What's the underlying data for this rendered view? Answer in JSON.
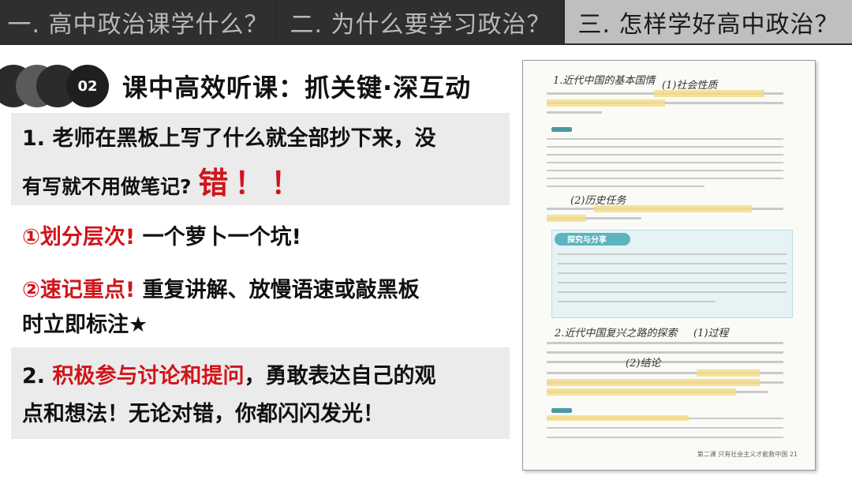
{
  "tabs": [
    {
      "label": "一. 高中政治课学什么？"
    },
    {
      "label": "二. 为什么要学习政治？"
    },
    {
      "label": "三. 怎样学好高中政治？"
    }
  ],
  "section": {
    "number": "02",
    "title": "课中高效听课：抓关键·深互动"
  },
  "point1": {
    "line1": "1. 老师在黑板上写了什么就全部抄下来，没",
    "line2": "有写就不用做笔记?",
    "verdict": "错！！"
  },
  "tip1": {
    "label": "①划分层次!",
    "text": "一个萝卜一个坑!"
  },
  "tip2": {
    "label": "②速记重点!",
    "text_line1": "重复讲解、放慢语速或敲黑板",
    "text_line2": "时立即标注★"
  },
  "point2": {
    "prefix": "2. ",
    "highlight": "积极参与讨论和提问",
    "rest_line1": "，勇敢表达自己的观",
    "line2": "点和想法！无论对错，你都闪闪发光！"
  },
  "textbook_page": {
    "annotations": [
      "1.近代中国的基本国情",
      "(1)社会性质",
      "(2)历史任务",
      "2.近代中国复兴之路的探索",
      "(1)过程",
      "(2)结论"
    ],
    "teal_header": "探究与分享",
    "footer": "第二课 只有社会主义才能救中国 21"
  }
}
